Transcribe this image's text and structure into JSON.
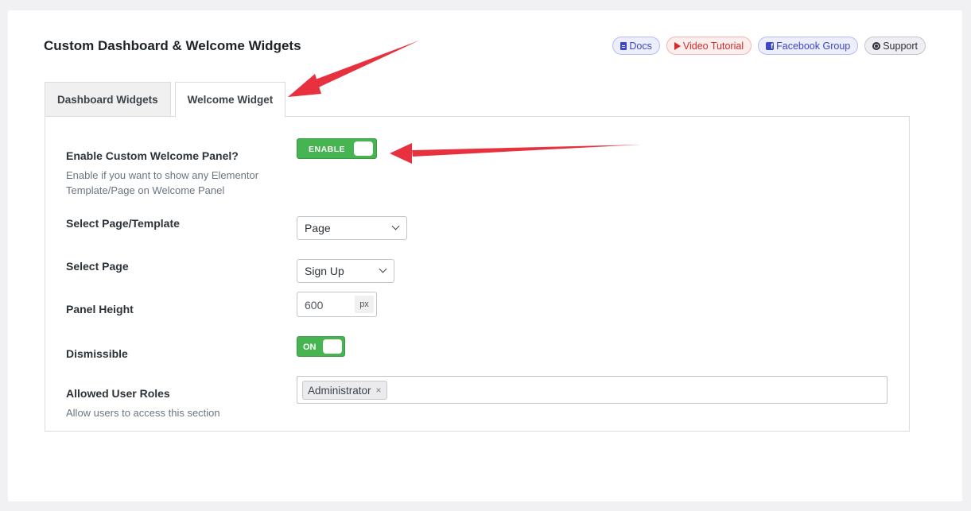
{
  "header": {
    "title": "Custom Dashboard & Welcome Widgets",
    "links": {
      "docs": "Docs",
      "video": "Video Tutorial",
      "facebook": "Facebook Group",
      "support": "Support"
    }
  },
  "tabs": [
    {
      "label": "Dashboard Widgets",
      "active": false
    },
    {
      "label": "Welcome Widget",
      "active": true
    }
  ],
  "fields": {
    "enable_panel": {
      "label": "Enable Custom Welcome Panel?",
      "description": "Enable if you want to show any Elementor Template/Page on Welcome Panel",
      "toggle_text": "ENABLE",
      "value": true
    },
    "page_template": {
      "label": "Select Page/Template",
      "value": "Page"
    },
    "select_page": {
      "label": "Select Page",
      "value": "Sign Up"
    },
    "panel_height": {
      "label": "Panel Height",
      "value": "600",
      "unit": "px"
    },
    "dismissible": {
      "label": "Dismissible",
      "toggle_text": "ON",
      "value": true
    },
    "user_roles": {
      "label": "Allowed User Roles",
      "description": "Allow users to access this section",
      "selected": [
        "Administrator"
      ],
      "remove_glyph": "×"
    }
  },
  "colors": {
    "toggle_green": "#46b450",
    "annotation_red": "#e8313e"
  },
  "icons": [
    "document-icon",
    "play-icon",
    "facebook-icon",
    "support-icon",
    "chevron-down-icon",
    "close-icon",
    "annotation-arrow"
  ]
}
